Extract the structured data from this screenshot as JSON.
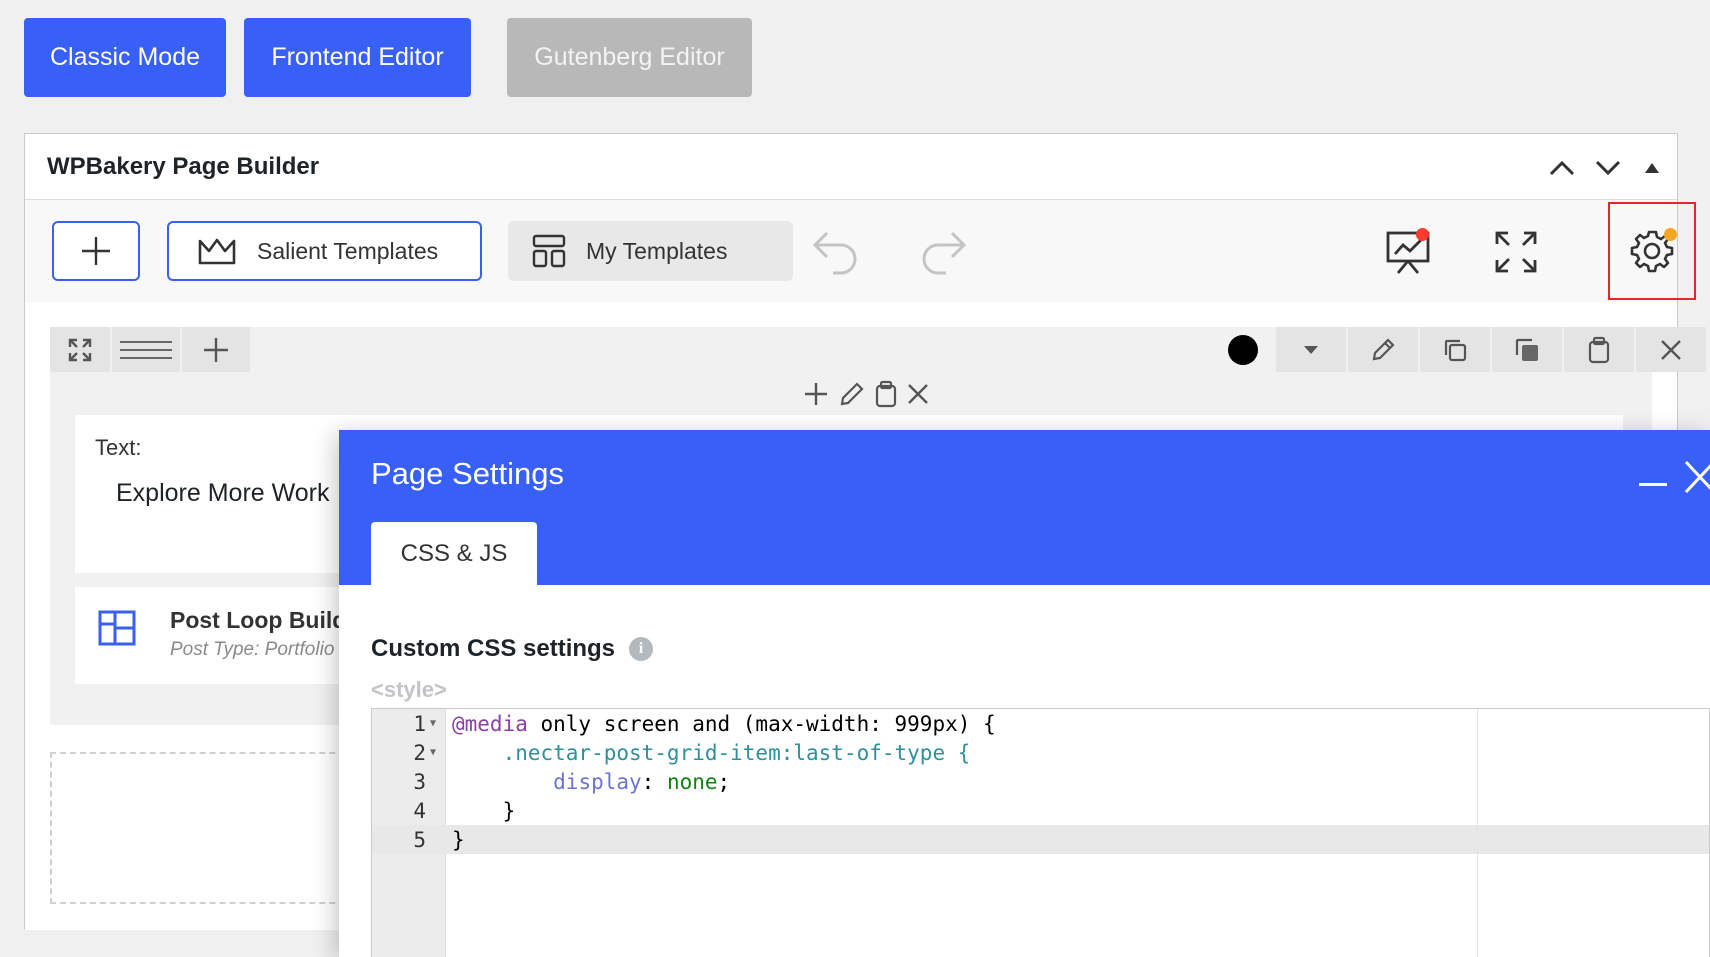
{
  "modes": {
    "classic": "Classic Mode",
    "frontend": "Frontend Editor",
    "gutenberg": "Gutenberg Editor"
  },
  "panel": {
    "title": "WPBakery Page Builder"
  },
  "toolbar": {
    "salient_templates": "Salient Templates",
    "my_templates": "My Templates",
    "accent_color": "#3860f6",
    "notification_dot_red": "#ff3b30",
    "notification_dot_orange": "#f5a623",
    "highlight_border": "#e0282d"
  },
  "canvas": {
    "text_element": {
      "label": "Text:",
      "content": "Explore More Work"
    },
    "post_loop": {
      "title": "Post Loop Builder",
      "subtitle": "Post Type: Portfolio"
    }
  },
  "modal": {
    "title": "Page Settings",
    "tab": "CSS & JS",
    "section_title": "Custom CSS settings",
    "style_tag": "<style>",
    "code_lines": [
      {
        "no": "1",
        "fold": true
      },
      {
        "no": "2",
        "fold": true
      },
      {
        "no": "3",
        "fold": false
      },
      {
        "no": "4",
        "fold": false
      },
      {
        "no": "5",
        "fold": false
      }
    ],
    "code": {
      "l1_at": "@media",
      "l1_rest": " only screen and (max-width: 999px) {",
      "l2_sel": "    .nectar-post-grid-item",
      "l2_rest": ":last-of-type {",
      "l3_indent": "        ",
      "l3_prop": "display",
      "l3_colon": ": ",
      "l3_val": "none",
      "l3_semi": ";",
      "l4": "    }",
      "l5": "}"
    }
  }
}
